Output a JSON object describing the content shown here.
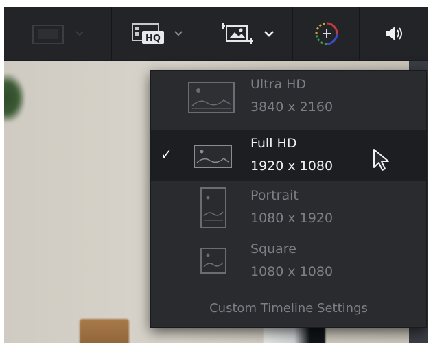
{
  "toolbar": {
    "buttons": [
      {
        "icon": "monitor-icon",
        "has_dropdown": true,
        "enabled": false
      },
      {
        "icon": "hq-proxy-icon",
        "icon_text": "HQ",
        "has_dropdown": true,
        "enabled": true
      },
      {
        "icon": "timeline-resolution-icon",
        "has_dropdown": true,
        "enabled": true,
        "active": true
      },
      {
        "icon": "color-wheel-icon",
        "has_dropdown": false,
        "enabled": true
      },
      {
        "icon": "speaker-icon",
        "has_dropdown": false,
        "enabled": true
      }
    ]
  },
  "menu": {
    "items": [
      {
        "title": "Ultra HD",
        "subtitle": "3840 x 2160",
        "selected": false,
        "thumb": "landscape-large-thumb-icon"
      },
      {
        "title": "Full HD",
        "subtitle": "1920 x 1080",
        "selected": true,
        "thumb": "landscape-thumb-icon"
      },
      {
        "title": "Portrait",
        "subtitle": "1080 x 1920",
        "selected": false,
        "thumb": "portrait-thumb-icon"
      },
      {
        "title": "Square",
        "subtitle": "1080 x 1080",
        "selected": false,
        "thumb": "square-thumb-icon"
      }
    ],
    "check_glyph": "✓",
    "footer": "Custom Timeline Settings"
  },
  "colors": {
    "toolbar_bg": "#232428",
    "menu_bg": "#2a2b2f",
    "selected_bg": "#1d1e21",
    "text_muted": "#7d7f85",
    "text_active": "#f1f1f2"
  }
}
